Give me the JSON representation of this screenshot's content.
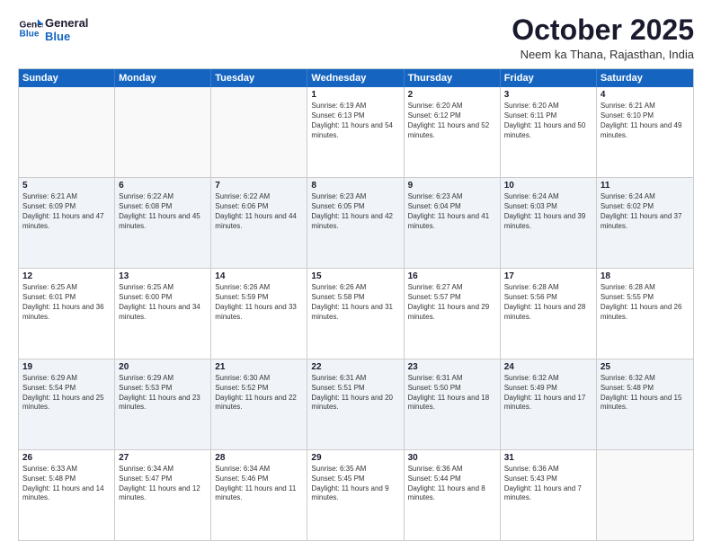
{
  "logo": {
    "line1": "General",
    "line2": "Blue"
  },
  "title": "October 2025",
  "subtitle": "Neem ka Thana, Rajasthan, India",
  "days_of_week": [
    "Sunday",
    "Monday",
    "Tuesday",
    "Wednesday",
    "Thursday",
    "Friday",
    "Saturday"
  ],
  "weeks": [
    [
      {
        "day": "",
        "sunrise": "",
        "sunset": "",
        "daylight": ""
      },
      {
        "day": "",
        "sunrise": "",
        "sunset": "",
        "daylight": ""
      },
      {
        "day": "",
        "sunrise": "",
        "sunset": "",
        "daylight": ""
      },
      {
        "day": "1",
        "sunrise": "Sunrise: 6:19 AM",
        "sunset": "Sunset: 6:13 PM",
        "daylight": "Daylight: 11 hours and 54 minutes."
      },
      {
        "day": "2",
        "sunrise": "Sunrise: 6:20 AM",
        "sunset": "Sunset: 6:12 PM",
        "daylight": "Daylight: 11 hours and 52 minutes."
      },
      {
        "day": "3",
        "sunrise": "Sunrise: 6:20 AM",
        "sunset": "Sunset: 6:11 PM",
        "daylight": "Daylight: 11 hours and 50 minutes."
      },
      {
        "day": "4",
        "sunrise": "Sunrise: 6:21 AM",
        "sunset": "Sunset: 6:10 PM",
        "daylight": "Daylight: 11 hours and 49 minutes."
      }
    ],
    [
      {
        "day": "5",
        "sunrise": "Sunrise: 6:21 AM",
        "sunset": "Sunset: 6:09 PM",
        "daylight": "Daylight: 11 hours and 47 minutes."
      },
      {
        "day": "6",
        "sunrise": "Sunrise: 6:22 AM",
        "sunset": "Sunset: 6:08 PM",
        "daylight": "Daylight: 11 hours and 45 minutes."
      },
      {
        "day": "7",
        "sunrise": "Sunrise: 6:22 AM",
        "sunset": "Sunset: 6:06 PM",
        "daylight": "Daylight: 11 hours and 44 minutes."
      },
      {
        "day": "8",
        "sunrise": "Sunrise: 6:23 AM",
        "sunset": "Sunset: 6:05 PM",
        "daylight": "Daylight: 11 hours and 42 minutes."
      },
      {
        "day": "9",
        "sunrise": "Sunrise: 6:23 AM",
        "sunset": "Sunset: 6:04 PM",
        "daylight": "Daylight: 11 hours and 41 minutes."
      },
      {
        "day": "10",
        "sunrise": "Sunrise: 6:24 AM",
        "sunset": "Sunset: 6:03 PM",
        "daylight": "Daylight: 11 hours and 39 minutes."
      },
      {
        "day": "11",
        "sunrise": "Sunrise: 6:24 AM",
        "sunset": "Sunset: 6:02 PM",
        "daylight": "Daylight: 11 hours and 37 minutes."
      }
    ],
    [
      {
        "day": "12",
        "sunrise": "Sunrise: 6:25 AM",
        "sunset": "Sunset: 6:01 PM",
        "daylight": "Daylight: 11 hours and 36 minutes."
      },
      {
        "day": "13",
        "sunrise": "Sunrise: 6:25 AM",
        "sunset": "Sunset: 6:00 PM",
        "daylight": "Daylight: 11 hours and 34 minutes."
      },
      {
        "day": "14",
        "sunrise": "Sunrise: 6:26 AM",
        "sunset": "Sunset: 5:59 PM",
        "daylight": "Daylight: 11 hours and 33 minutes."
      },
      {
        "day": "15",
        "sunrise": "Sunrise: 6:26 AM",
        "sunset": "Sunset: 5:58 PM",
        "daylight": "Daylight: 11 hours and 31 minutes."
      },
      {
        "day": "16",
        "sunrise": "Sunrise: 6:27 AM",
        "sunset": "Sunset: 5:57 PM",
        "daylight": "Daylight: 11 hours and 29 minutes."
      },
      {
        "day": "17",
        "sunrise": "Sunrise: 6:28 AM",
        "sunset": "Sunset: 5:56 PM",
        "daylight": "Daylight: 11 hours and 28 minutes."
      },
      {
        "day": "18",
        "sunrise": "Sunrise: 6:28 AM",
        "sunset": "Sunset: 5:55 PM",
        "daylight": "Daylight: 11 hours and 26 minutes."
      }
    ],
    [
      {
        "day": "19",
        "sunrise": "Sunrise: 6:29 AM",
        "sunset": "Sunset: 5:54 PM",
        "daylight": "Daylight: 11 hours and 25 minutes."
      },
      {
        "day": "20",
        "sunrise": "Sunrise: 6:29 AM",
        "sunset": "Sunset: 5:53 PM",
        "daylight": "Daylight: 11 hours and 23 minutes."
      },
      {
        "day": "21",
        "sunrise": "Sunrise: 6:30 AM",
        "sunset": "Sunset: 5:52 PM",
        "daylight": "Daylight: 11 hours and 22 minutes."
      },
      {
        "day": "22",
        "sunrise": "Sunrise: 6:31 AM",
        "sunset": "Sunset: 5:51 PM",
        "daylight": "Daylight: 11 hours and 20 minutes."
      },
      {
        "day": "23",
        "sunrise": "Sunrise: 6:31 AM",
        "sunset": "Sunset: 5:50 PM",
        "daylight": "Daylight: 11 hours and 18 minutes."
      },
      {
        "day": "24",
        "sunrise": "Sunrise: 6:32 AM",
        "sunset": "Sunset: 5:49 PM",
        "daylight": "Daylight: 11 hours and 17 minutes."
      },
      {
        "day": "25",
        "sunrise": "Sunrise: 6:32 AM",
        "sunset": "Sunset: 5:48 PM",
        "daylight": "Daylight: 11 hours and 15 minutes."
      }
    ],
    [
      {
        "day": "26",
        "sunrise": "Sunrise: 6:33 AM",
        "sunset": "Sunset: 5:48 PM",
        "daylight": "Daylight: 11 hours and 14 minutes."
      },
      {
        "day": "27",
        "sunrise": "Sunrise: 6:34 AM",
        "sunset": "Sunset: 5:47 PM",
        "daylight": "Daylight: 11 hours and 12 minutes."
      },
      {
        "day": "28",
        "sunrise": "Sunrise: 6:34 AM",
        "sunset": "Sunset: 5:46 PM",
        "daylight": "Daylight: 11 hours and 11 minutes."
      },
      {
        "day": "29",
        "sunrise": "Sunrise: 6:35 AM",
        "sunset": "Sunset: 5:45 PM",
        "daylight": "Daylight: 11 hours and 9 minutes."
      },
      {
        "day": "30",
        "sunrise": "Sunrise: 6:36 AM",
        "sunset": "Sunset: 5:44 PM",
        "daylight": "Daylight: 11 hours and 8 minutes."
      },
      {
        "day": "31",
        "sunrise": "Sunrise: 6:36 AM",
        "sunset": "Sunset: 5:43 PM",
        "daylight": "Daylight: 11 hours and 7 minutes."
      },
      {
        "day": "",
        "sunrise": "",
        "sunset": "",
        "daylight": ""
      }
    ]
  ]
}
